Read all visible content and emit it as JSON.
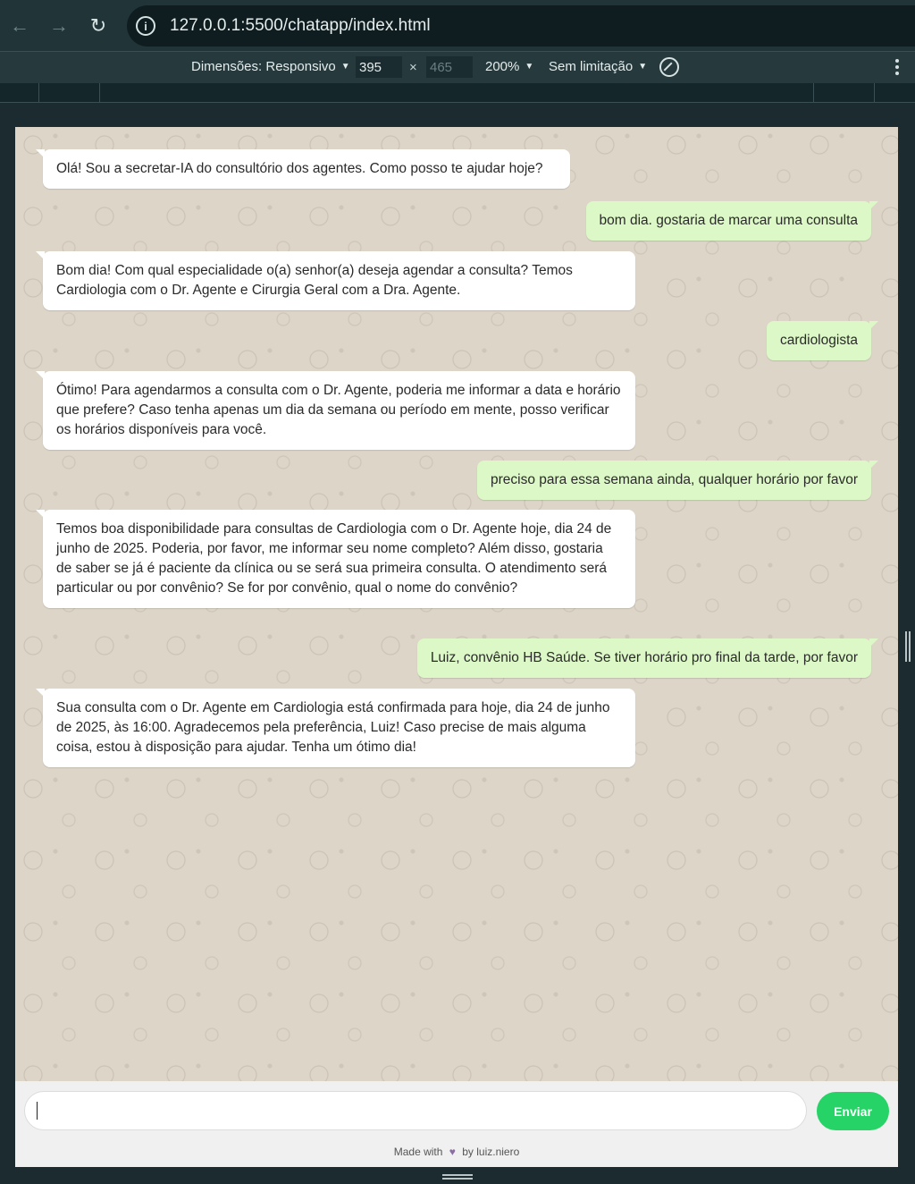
{
  "browser": {
    "url": "127.0.0.1:5500/chatapp/index.html"
  },
  "device_toolbar": {
    "dimensions_label": "Dimensões: Responsivo",
    "width": "395",
    "height": "465",
    "zoom": "200%",
    "throttle": "Sem limitação"
  },
  "chat": {
    "messages": [
      {
        "sender": "bot",
        "text": "Olá! Sou a secretar-IA do consultório dos agentes. Como posso te ajudar hoje?"
      },
      {
        "sender": "user",
        "text": "bom dia. gostaria de marcar uma consulta"
      },
      {
        "sender": "bot",
        "text": "Bom dia! Com qual especialidade o(a) senhor(a) deseja agendar a consulta? Temos Cardiologia com o Dr. Agente e Cirurgia Geral com a Dra. Agente."
      },
      {
        "sender": "user",
        "text": "cardiologista"
      },
      {
        "sender": "bot",
        "text": "Ótimo! Para agendarmos a consulta com o Dr. Agente, poderia me informar a data e horário que prefere? Caso tenha apenas um dia da semana ou período em mente, posso verificar os horários disponíveis para você."
      },
      {
        "sender": "user",
        "text": "preciso para essa semana ainda, qualquer horário por favor"
      },
      {
        "sender": "bot",
        "text": "Temos boa disponibilidade para consultas de Cardiologia com o Dr. Agente hoje, dia 24 de junho de 2025. Poderia, por favor, me informar seu nome completo? Além disso, gostaria de saber se já é paciente da clínica ou se será sua primeira consulta. O atendimento será particular ou por convênio? Se for por convênio, qual o nome do convênio?"
      },
      {
        "sender": "user",
        "text": "Luiz, convênio HB Saúde. Se tiver horário pro final da tarde, por favor"
      },
      {
        "sender": "bot",
        "text": "Sua consulta com o Dr. Agente em Cardiologia está confirmada para hoje, dia 24 de junho de 2025, às 16:00. Agradecemos pela preferência, Luiz! Caso precise de mais alguma coisa, estou à disposição para ajudar. Tenha um ótimo dia!"
      }
    ]
  },
  "composer": {
    "input_value": "",
    "send_label": "Enviar"
  },
  "footer": {
    "made_with": "Made with",
    "heart": "♥",
    "by": "by luiz.niero"
  }
}
